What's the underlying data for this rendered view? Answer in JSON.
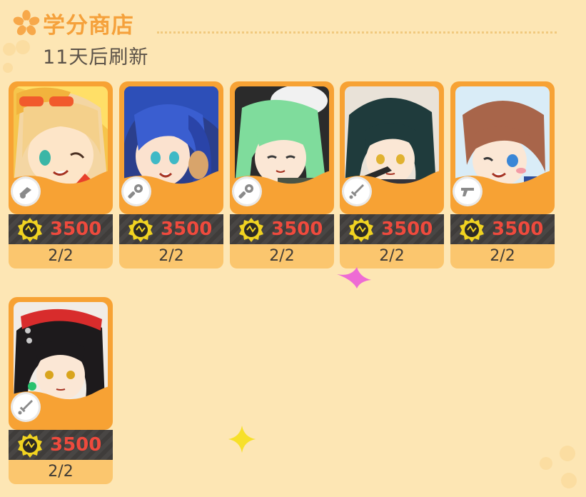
{
  "header": {
    "title": "学分商店",
    "refresh_text": "11天后刷新"
  },
  "colors": {
    "background": "#fde6b4",
    "title": "#f5a13b",
    "card_frame": "#f7a234",
    "price": "#ef4a3d",
    "price_bar": "#3f3c3a",
    "stock_bar": "#fbc66e"
  },
  "items": [
    {
      "character": "blonde-girl-with-sunglasses",
      "role_icon": "cannon-icon",
      "currency_icon": "credit-coin-icon",
      "price": "3500",
      "stock": "2/2"
    },
    {
      "character": "blue-haired-girl",
      "role_icon": "wrench-icon",
      "currency_icon": "credit-coin-icon",
      "price": "3500",
      "stock": "2/2"
    },
    {
      "character": "green-haired-girl",
      "role_icon": "wrench-icon",
      "currency_icon": "credit-coin-icon",
      "price": "3500",
      "stock": "2/2"
    },
    {
      "character": "dark-teal-haired-girl",
      "role_icon": "sword-icon",
      "currency_icon": "credit-coin-icon",
      "price": "3500",
      "stock": "2/2"
    },
    {
      "character": "brown-haired-girl-winking",
      "role_icon": "gun-icon",
      "currency_icon": "credit-coin-icon",
      "price": "3500",
      "stock": "2/2"
    },
    {
      "character": "black-haired-girl-red-headband",
      "role_icon": "sword-icon",
      "currency_icon": "credit-coin-icon",
      "price": "3500",
      "stock": "2/2"
    }
  ]
}
